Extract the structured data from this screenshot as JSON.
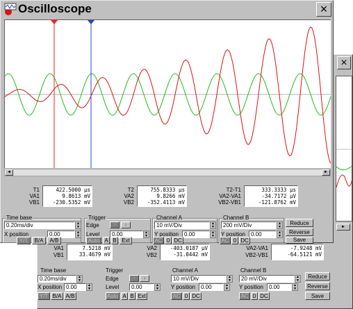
{
  "back_window": {
    "close_glyph": "×",
    "readout": {
      "a_labels": [
        "VA1",
        "VB1"
      ],
      "a_values": [
        "7.5218 mV",
        "33.4679 mV"
      ],
      "b_labels": [
        "VA2",
        "VB2"
      ],
      "b_values": [
        "-403.0187 µV",
        "-31.0442 mV"
      ],
      "c_labels": [
        "VA2-VA1",
        "VB2-VB1"
      ],
      "c_values": [
        "-7.9248 mV",
        "-64.5121 mV"
      ]
    },
    "timebase": {
      "title": "Time base",
      "value": "0.20ms/div",
      "xpos_label": "X position",
      "xpos": "0.00",
      "buttons": [
        "Y/T",
        "B/A",
        "A/B"
      ]
    },
    "trigger": {
      "title": "Trigger",
      "edge_label": "Edge",
      "level_label": "Level",
      "level": "0.00",
      "buttons": [
        "Auto",
        "A",
        "B",
        "Ext"
      ]
    },
    "channel_a": {
      "title": "Channel A",
      "value": "10 mV/Div",
      "ypos_label": "Y position",
      "ypos": "0.00",
      "buttons": [
        "AC",
        "0",
        "DC"
      ]
    },
    "channel_b": {
      "title": "Channel B",
      "value": "20 mV/Div",
      "ypos_label": "Y position",
      "ypos": "0.00",
      "buttons": [
        "AC",
        "0",
        "DC"
      ]
    },
    "actions": [
      "Reduce",
      "Reverse",
      "Save"
    ]
  },
  "front_window": {
    "title": "Oscilloscope",
    "close_glyph": "×",
    "scroll_left": "◄",
    "scroll_right": "►",
    "cursor1_label": "1",
    "cursor2_label": "2",
    "readout": {
      "t1_labels": [
        "T1",
        "VA1",
        "VB1"
      ],
      "t1_values": [
        "422.5000 µs",
        "9.8613 mV",
        "-230.5352 mV"
      ],
      "t2_labels": [
        "T2",
        "VA2",
        "VB2"
      ],
      "t2_values": [
        "755.8333 µs",
        "9.8266 mV",
        "-352.4113 mV"
      ],
      "d_labels": [
        "T2-T1",
        "VA2-VA1",
        "VB2-VB1"
      ],
      "d_values": [
        "333.3333 µs",
        "-34.7172 µV",
        "-121.8762 mV"
      ]
    },
    "timebase": {
      "title": "Time base",
      "value": "0.20ms/div",
      "xpos_label": "X position",
      "xpos": "0.00",
      "buttons": [
        "Y/T",
        "B/A",
        "A/B"
      ]
    },
    "trigger": {
      "title": "Trigger",
      "edge_label": "Edge",
      "level_label": "Level",
      "level": "0.00",
      "buttons": [
        "Auto",
        "A",
        "B",
        "Ext"
      ]
    },
    "channel_a": {
      "title": "Channel A",
      "value": "10 mV/Div",
      "ypos_label": "Y position",
      "ypos": "0.00",
      "buttons": [
        "AC",
        "0",
        "DC"
      ]
    },
    "channel_b": {
      "title": "Channel B",
      "value": "200 mV/Div",
      "ypos_label": "Y position",
      "ypos": "0.00",
      "buttons": [
        "AC",
        "0",
        "DC"
      ]
    },
    "actions": [
      "Reduce",
      "Reverse",
      "Save"
    ]
  },
  "colors": {
    "title_bar": "#c0c0c0",
    "trace_a": "#22bb22",
    "trace_b": "#dd1111",
    "cursor1": "#ee2222",
    "cursor2": "#2244cc"
  },
  "icons": {
    "app": "oscilloscope-icon"
  }
}
